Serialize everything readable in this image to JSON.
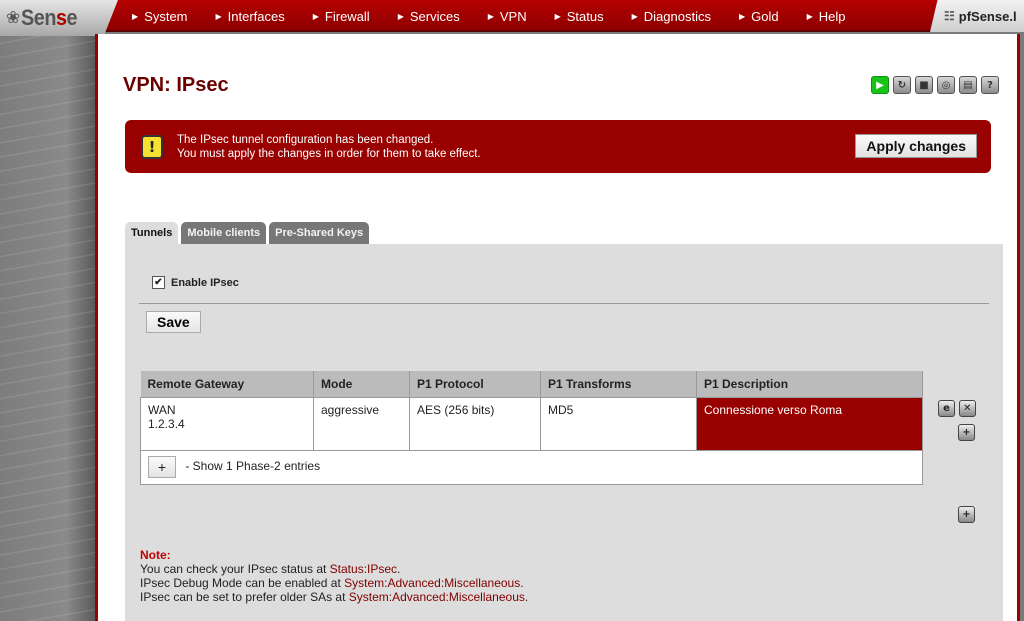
{
  "nav": {
    "logo": "Sense",
    "items": [
      {
        "label": "System"
      },
      {
        "label": "Interfaces"
      },
      {
        "label": "Firewall"
      },
      {
        "label": "Services"
      },
      {
        "label": "VPN"
      },
      {
        "label": "Status"
      },
      {
        "label": "Diagnostics"
      },
      {
        "label": "Gold"
      },
      {
        "label": "Help"
      }
    ],
    "host": "pfSense.l"
  },
  "page": {
    "title": "VPN: IPsec",
    "toolbar_icons": [
      "play-icon",
      "restart-icon",
      "stop-icon",
      "status-icon",
      "log-icon",
      "help-icon"
    ]
  },
  "alert": {
    "line1": "The IPsec tunnel configuration has been changed.",
    "line2": "You must apply the changes in order for them to take effect.",
    "button": "Apply changes"
  },
  "tabs": [
    {
      "label": "Tunnels",
      "active": true
    },
    {
      "label": "Mobile clients",
      "active": false
    },
    {
      "label": "Pre-Shared Keys",
      "active": false
    }
  ],
  "enable": {
    "label": "Enable IPsec",
    "checked": true,
    "mark": "✔"
  },
  "save_label": "Save",
  "table": {
    "headers": [
      "Remote Gateway",
      "Mode",
      "P1 Protocol",
      "P1 Transforms",
      "P1 Description"
    ],
    "rows": [
      {
        "gateway_if": "WAN",
        "gateway_ip": "1.2.3.4",
        "mode": "aggressive",
        "protocol": "AES (256 bits)",
        "transforms": "MD5",
        "description": "Connessione verso Roma"
      }
    ],
    "phase2_toggle": "+",
    "phase2_text": "- Show 1 Phase-2 entries"
  },
  "note": {
    "title": "Note:",
    "lines": [
      {
        "text": "You can check your IPsec status at ",
        "link": "Status:IPsec",
        "end": "."
      },
      {
        "text": "IPsec Debug Mode can be enabled at ",
        "link": "System:Advanced:Miscellaneous",
        "end": "."
      },
      {
        "text": "IPsec can be set to prefer older SAs at ",
        "link": "System:Advanced:Miscellaneous",
        "end": "."
      }
    ]
  }
}
